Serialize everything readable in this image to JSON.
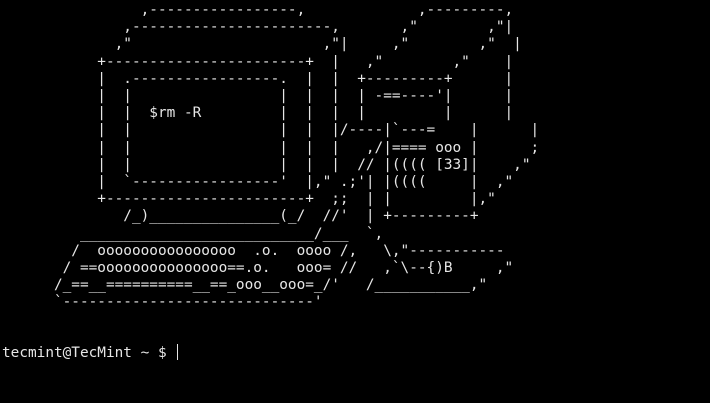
{
  "terminal": {
    "background": "#000000",
    "foreground": "#e6e6e6",
    "art_lines": [
      "                ,-----------------,             ,---------,",
      "              ,-----------------------,       ,\"        ,\"|",
      "             ,\"                      ,\"|     ,\"        ,\"  |",
      "           +-----------------------+  |   ,\"        ,\"    |",
      "           |  .-----------------.  |  |  +---------+      |",
      "           |  |                 |  |  |  | -==----'|      |",
      "           |  |  $rm -R         |  |  |  |         |      |",
      "           |  |                 |  |  |/----|`---=    |      |",
      "           |  |                 |  |  |   ,/|==== ooo |      ;",
      "           |  |                 |  |  |  // |(((( [33]|    ,\"",
      "           |  `-----------------'  |,\" .;'| |((((     |  ,\"",
      "           +-----------------------+  ;;  | |         |,\"",
      "              /_)_______________(_/  //'  | +---------+",
      "         ___________________________/___  `,",
      "        /  oooooooooooooooo  .o.  oooo /,   \\,\"-----------",
      "       / ==ooooooooooooooo==.o.   ooo= //   ,`\\--{)B     ,\"",
      "      /_==__==========__==_ooo__ooo=_/'   /___________,\"",
      "      `-----------------------------'"
    ],
    "prompt": {
      "text": "tecmint@TecMint ~ $ "
    }
  }
}
